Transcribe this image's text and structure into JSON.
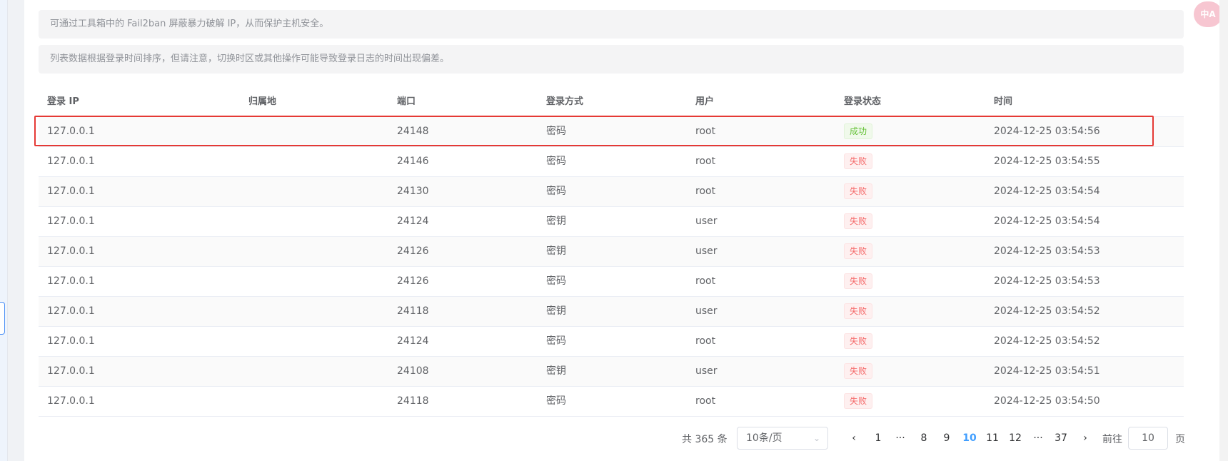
{
  "notices": [
    "可通过工具箱中的 Fail2ban 屏蔽暴力破解 IP，从而保护主机安全。",
    "列表数据根据登录时间排序，但请注意，切换时区或其他操作可能导致登录日志的时间出现偏差。"
  ],
  "table": {
    "headers": {
      "ip": "登录 IP",
      "location": "归属地",
      "port": "端口",
      "method": "登录方式",
      "user": "用户",
      "status": "登录状态",
      "time": "时间"
    },
    "rows": [
      {
        "ip": "127.0.0.1",
        "location": "",
        "port": "24148",
        "method": "密码",
        "user": "root",
        "status": "成功",
        "status_type": "success",
        "time": "2024-12-25 03:54:56"
      },
      {
        "ip": "127.0.0.1",
        "location": "",
        "port": "24146",
        "method": "密码",
        "user": "root",
        "status": "失败",
        "status_type": "fail",
        "time": "2024-12-25 03:54:55"
      },
      {
        "ip": "127.0.0.1",
        "location": "",
        "port": "24130",
        "method": "密码",
        "user": "root",
        "status": "失败",
        "status_type": "fail",
        "time": "2024-12-25 03:54:54"
      },
      {
        "ip": "127.0.0.1",
        "location": "",
        "port": "24124",
        "method": "密钥",
        "user": "user",
        "status": "失败",
        "status_type": "fail",
        "time": "2024-12-25 03:54:54"
      },
      {
        "ip": "127.0.0.1",
        "location": "",
        "port": "24126",
        "method": "密钥",
        "user": "user",
        "status": "失败",
        "status_type": "fail",
        "time": "2024-12-25 03:54:53"
      },
      {
        "ip": "127.0.0.1",
        "location": "",
        "port": "24126",
        "method": "密码",
        "user": "root",
        "status": "失败",
        "status_type": "fail",
        "time": "2024-12-25 03:54:53"
      },
      {
        "ip": "127.0.0.1",
        "location": "",
        "port": "24118",
        "method": "密钥",
        "user": "user",
        "status": "失败",
        "status_type": "fail",
        "time": "2024-12-25 03:54:52"
      },
      {
        "ip": "127.0.0.1",
        "location": "",
        "port": "24124",
        "method": "密码",
        "user": "root",
        "status": "失败",
        "status_type": "fail",
        "time": "2024-12-25 03:54:52"
      },
      {
        "ip": "127.0.0.1",
        "location": "",
        "port": "24108",
        "method": "密钥",
        "user": "user",
        "status": "失败",
        "status_type": "fail",
        "time": "2024-12-25 03:54:51"
      },
      {
        "ip": "127.0.0.1",
        "location": "",
        "port": "24118",
        "method": "密码",
        "user": "root",
        "status": "失败",
        "status_type": "fail",
        "time": "2024-12-25 03:54:50"
      }
    ]
  },
  "pagination": {
    "total": "共 365 条",
    "page_size": "10条/页",
    "prev": "‹",
    "next": "›",
    "pages": [
      "1",
      "···",
      "8",
      "9",
      "10",
      "11",
      "12",
      "···",
      "37"
    ],
    "current": "10",
    "goto_label": "前往",
    "goto_value": "10",
    "goto_unit": "页"
  },
  "floating_translate": "中A",
  "colors": {
    "success": "#67c23a",
    "fail": "#f56c6c",
    "active_page": "#409eff",
    "highlight_box": "#e53935"
  }
}
